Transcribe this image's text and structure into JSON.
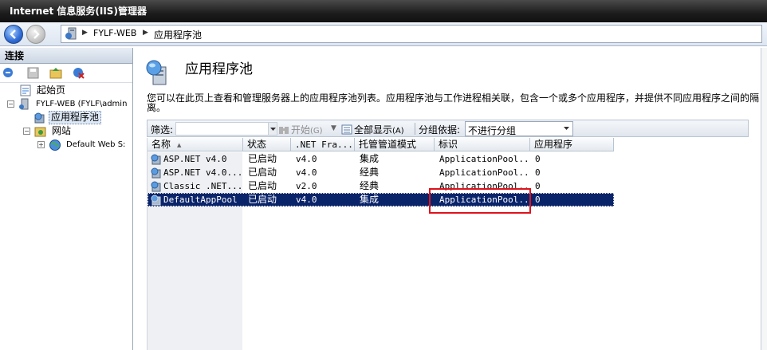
{
  "window": {
    "title": "Internet 信息服务(IIS)管理器"
  },
  "address": {
    "crumbs": [
      "FYLF-WEB",
      "应用程序池"
    ]
  },
  "connections": {
    "title": "连接",
    "tree": [
      {
        "label": "起始页"
      },
      {
        "label": "FYLF-WEB (FYLF\\admin"
      },
      {
        "label": "应用程序池"
      },
      {
        "label": "网站"
      },
      {
        "label": "Default Web S:"
      }
    ]
  },
  "page": {
    "title": "应用程序池",
    "description": "您可以在此页上查看和管理服务器上的应用程序池列表。应用程序池与工作进程相关联，包含一个或多个应用程序，并提供不同应用程序之间的隔离。"
  },
  "filter": {
    "label": "筛选:",
    "go": "开始",
    "go_key": "(G)",
    "show_all": "全部显示",
    "show_all_key": "(A)",
    "group_label": "分组依据:",
    "group_value": "不进行分组"
  },
  "grid": {
    "columns": [
      "名称",
      "状态",
      ".NET Fra...",
      "托管管道模式",
      "标识",
      "应用程序"
    ],
    "rows": [
      {
        "name": "ASP.NET v4.0",
        "status": "已启动",
        "net": "v4.0",
        "pipeline": "集成",
        "identity": "ApplicationPool...",
        "apps": "0"
      },
      {
        "name": "ASP.NET v4.0...",
        "status": "已启动",
        "net": "v4.0",
        "pipeline": "经典",
        "identity": "ApplicationPool...",
        "apps": "0"
      },
      {
        "name": "Classic .NET...",
        "status": "已启动",
        "net": "v2.0",
        "pipeline": "经典",
        "identity": "ApplicationPool...",
        "apps": "0"
      },
      {
        "name": "DefaultAppPool",
        "status": "已启动",
        "net": "v4.0",
        "pipeline": "集成",
        "identity": "ApplicationPool...",
        "apps": "0"
      }
    ],
    "selected_row": 3
  },
  "colors": {
    "selection": "#0a246a",
    "annotation": "#e0121c",
    "titlebar": "#1c1c1c"
  },
  "icons": [
    "back-arrow-icon",
    "forward-arrow-icon",
    "server-icon",
    "start-page-icon",
    "app-pool-icon",
    "sites-icon",
    "globe-icon",
    "pool-row-icon"
  ]
}
